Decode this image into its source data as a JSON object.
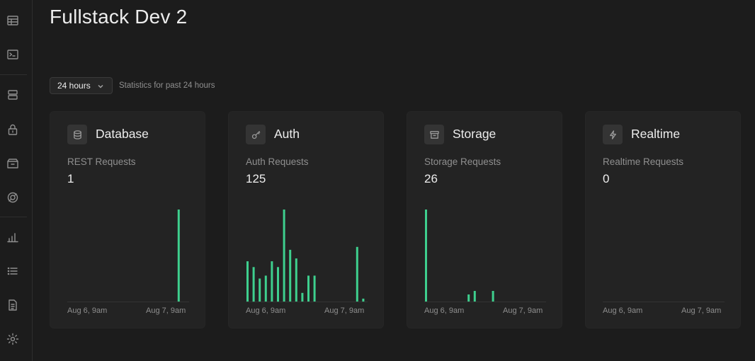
{
  "page": {
    "title": "Fullstack Dev 2"
  },
  "sidebar": {
    "items": [
      {
        "icon": "table-editor-icon"
      },
      {
        "icon": "sql-editor-icon"
      },
      {
        "icon": "database-icon"
      },
      {
        "icon": "auth-lock-icon"
      },
      {
        "icon": "storage-box-icon"
      },
      {
        "icon": "edge-functions-icon"
      },
      {
        "icon": "reports-chart-icon"
      },
      {
        "icon": "logs-list-icon"
      },
      {
        "icon": "docs-file-icon"
      },
      {
        "icon": "settings-gear-icon"
      }
    ]
  },
  "range": {
    "selected": "24 hours",
    "description": "Statistics for past 24 hours"
  },
  "colors": {
    "bar": "#3ecf8e",
    "background": "#1c1c1c",
    "card": "#232323"
  },
  "cards": [
    {
      "title": "Database",
      "subtitle": "REST Requests",
      "value": "1",
      "icon": "database-icon"
    },
    {
      "title": "Auth",
      "subtitle": "Auth Requests",
      "value": "125",
      "icon": "key-icon"
    },
    {
      "title": "Storage",
      "subtitle": "Storage Requests",
      "value": "26",
      "icon": "archive-icon"
    },
    {
      "title": "Realtime",
      "subtitle": "Realtime Requests",
      "value": "0",
      "icon": "bolt-icon"
    }
  ],
  "chart_data": [
    {
      "type": "bar",
      "title": "REST Requests",
      "x_tick_labels": [
        "Aug 6, 9am",
        "Aug 7, 9am"
      ],
      "values": [
        0,
        0,
        0,
        0,
        0,
        0,
        0,
        0,
        0,
        0,
        0,
        0,
        0,
        0,
        0,
        0,
        0,
        0,
        1,
        0
      ],
      "ylim": [
        0,
        1
      ]
    },
    {
      "type": "bar",
      "title": "Auth Requests",
      "x_tick_labels": [
        "Aug 6, 9am",
        "Aug 7, 9am"
      ],
      "values": [
        14,
        12,
        8,
        9,
        14,
        12,
        32,
        18,
        15,
        3,
        9,
        9,
        0,
        0,
        0,
        0,
        0,
        0,
        19,
        1
      ],
      "ylim": [
        0,
        32
      ]
    },
    {
      "type": "bar",
      "title": "Storage Requests",
      "x_tick_labels": [
        "Aug 6, 9am",
        "Aug 7, 9am"
      ],
      "values": [
        13,
        0,
        0,
        0,
        0,
        0,
        0,
        1,
        1.5,
        0,
        0,
        1.5,
        0,
        0,
        0,
        0,
        0,
        0,
        0,
        0
      ],
      "ylim": [
        0,
        13
      ]
    },
    {
      "type": "bar",
      "title": "Realtime Requests",
      "x_tick_labels": [
        "Aug 6, 9am",
        "Aug 7, 9am"
      ],
      "values": [
        0,
        0,
        0,
        0,
        0,
        0,
        0,
        0,
        0,
        0,
        0,
        0,
        0,
        0,
        0,
        0,
        0,
        0,
        0,
        0
      ],
      "ylim": [
        0,
        1
      ]
    }
  ]
}
